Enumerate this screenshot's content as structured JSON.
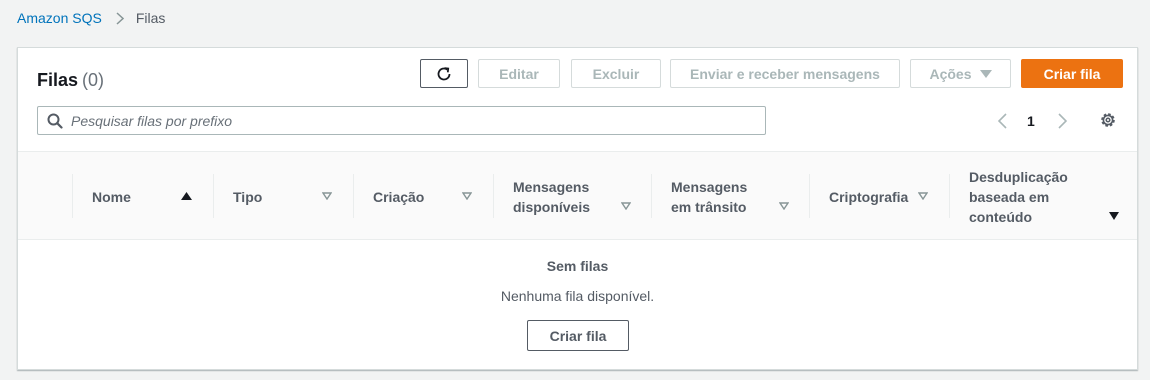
{
  "breadcrumb": {
    "root": "Amazon SQS",
    "current": "Filas"
  },
  "header": {
    "title": "Filas",
    "count": "(0)"
  },
  "toolbar": {
    "edit": "Editar",
    "delete": "Excluir",
    "send_receive": "Enviar e receber mensagens",
    "actions": "Ações",
    "create": "Criar fila"
  },
  "search": {
    "placeholder": "Pesquisar filas por prefixo"
  },
  "pagination": {
    "page": "1"
  },
  "table": {
    "columns": [
      {
        "label": "Nome",
        "sort": "ascending"
      },
      {
        "label": "Tipo",
        "sort": "none"
      },
      {
        "label": "Criação",
        "sort": "none"
      },
      {
        "label": "Mensagens disponíveis",
        "sort": "none"
      },
      {
        "label": "Mensagens em trânsito",
        "sort": "none"
      },
      {
        "label": "Criptografia",
        "sort": "none"
      },
      {
        "label": "Desduplicação baseada em conteúdo",
        "sort": "descending"
      }
    ]
  },
  "empty_state": {
    "title": "Sem filas",
    "message": "Nenhuma fila disponível.",
    "button": "Criar fila"
  },
  "colors": {
    "accent": "#ec7211",
    "link": "#0073bb"
  }
}
